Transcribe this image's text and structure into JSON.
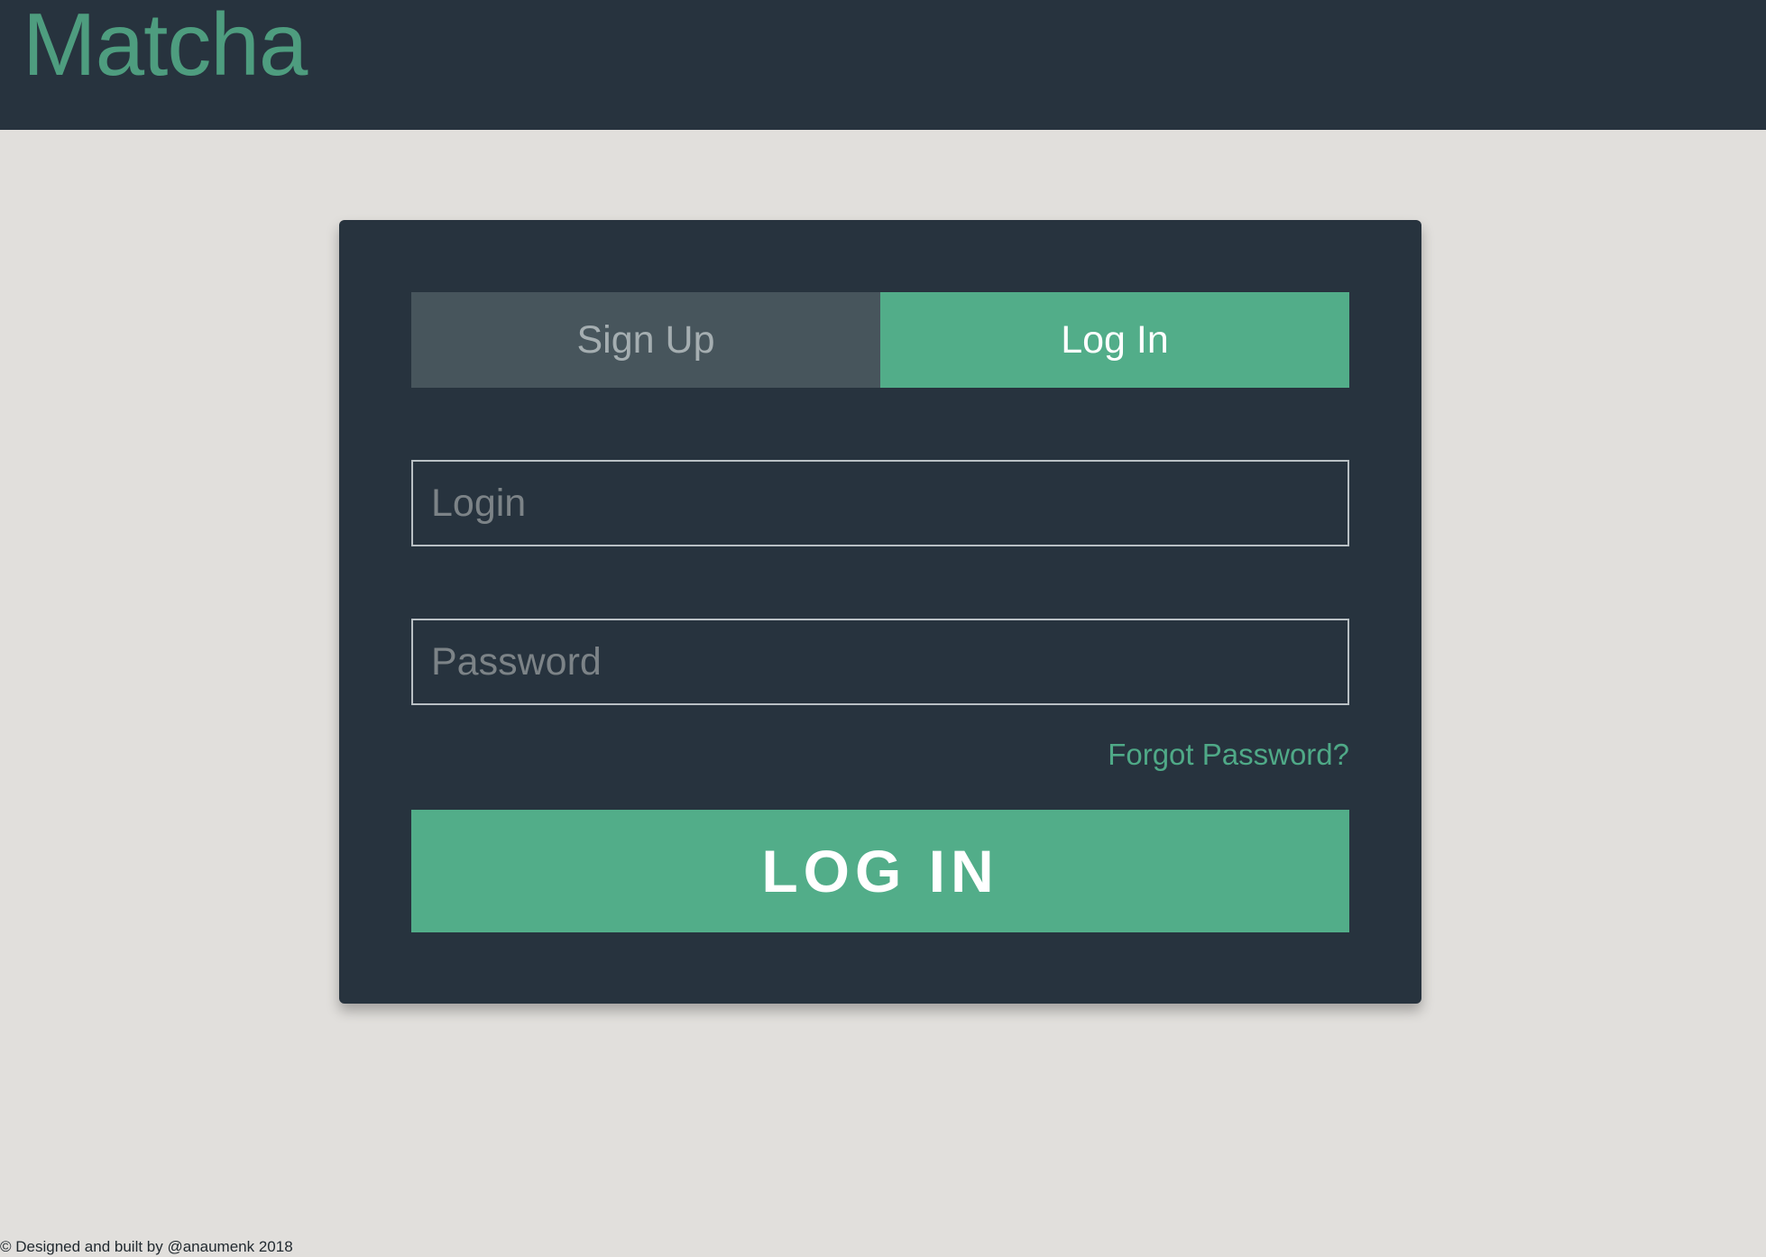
{
  "header": {
    "brand": "Matcha"
  },
  "auth": {
    "tabs": [
      {
        "label": "Sign Up",
        "active": false
      },
      {
        "label": "Log In",
        "active": true
      }
    ],
    "login_placeholder": "Login",
    "password_placeholder": "Password",
    "forgot_label": "Forgot Password?",
    "submit_label": "LOG IN"
  },
  "footer": {
    "text": "© Designed and built by @anaumenk 2018"
  },
  "colors": {
    "accent": "#52ad89",
    "header_bg": "#27333e",
    "page_bg": "#e1dfdc",
    "inactive_tab_bg": "#47555c"
  }
}
